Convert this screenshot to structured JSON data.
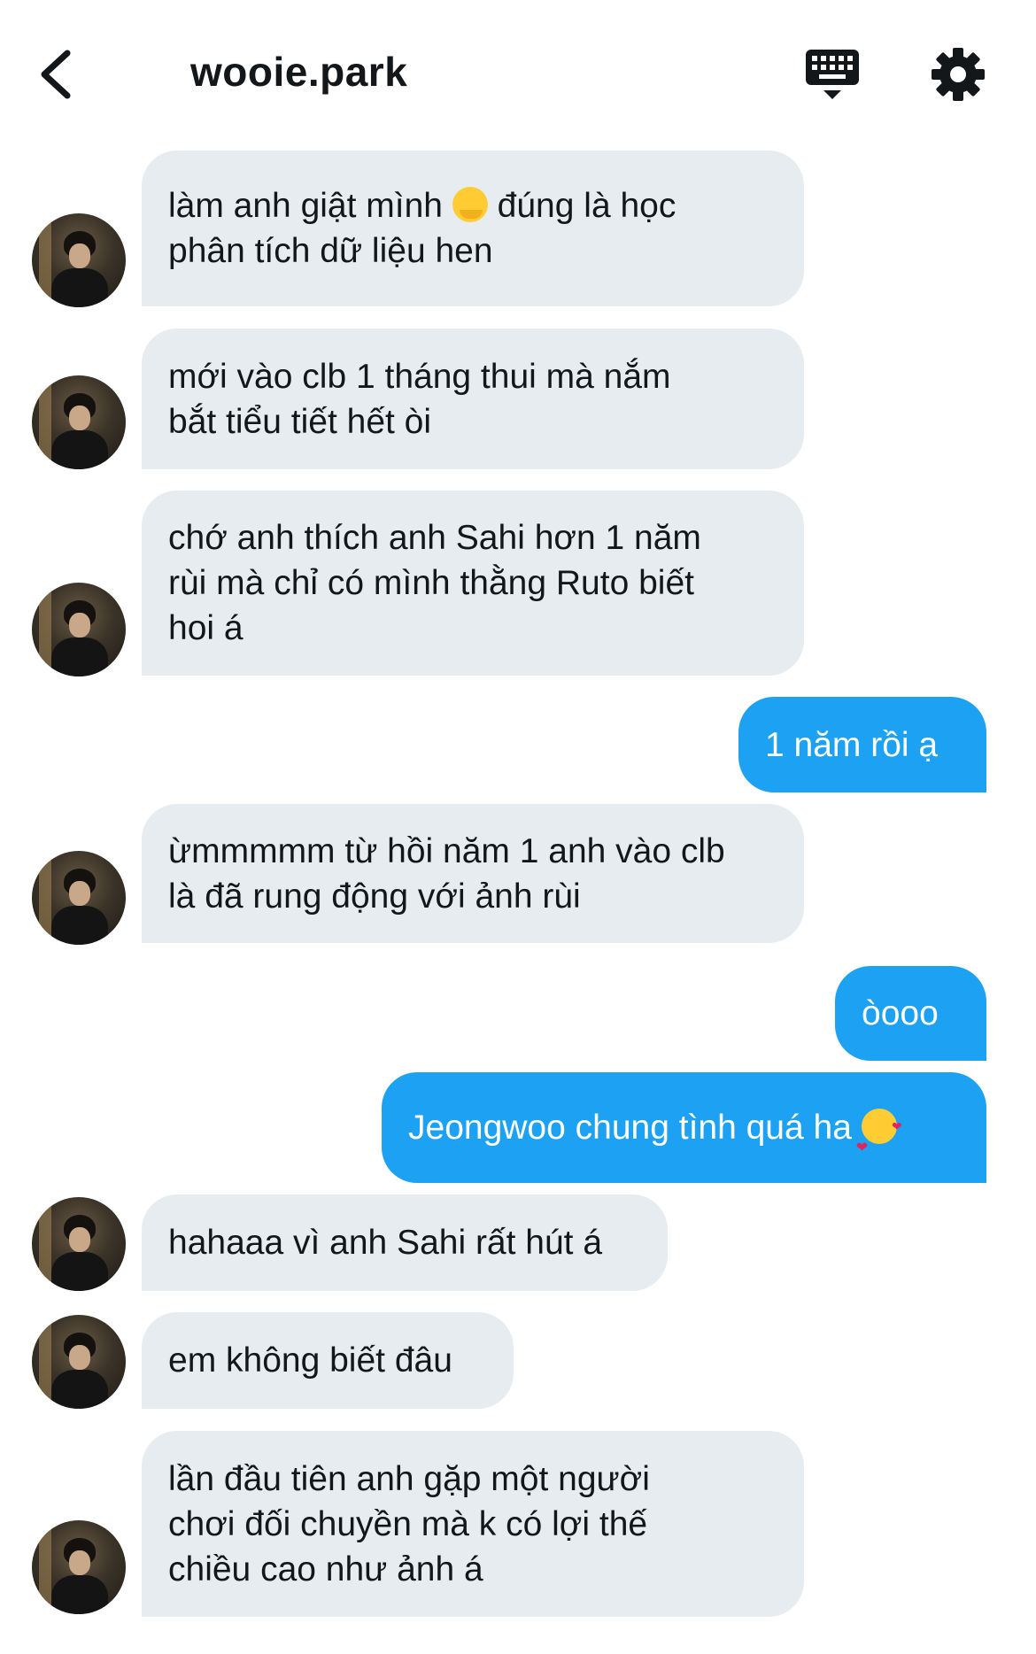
{
  "header": {
    "title": "wooie.park",
    "back_icon": "chevron-left-icon",
    "keyboard_icon": "keyboard-icon",
    "settings_icon": "gear-icon"
  },
  "colors": {
    "incoming_bubble": "#e6ecf0",
    "outgoing_bubble": "#1da1f2",
    "text": "#14171a"
  },
  "messages": [
    {
      "from": "them",
      "text_before": "làm anh giật mình ",
      "emoji": "melting-face-emoji",
      "text_after": " đúng là học\nphân tích dữ liệu hen"
    },
    {
      "from": "them",
      "text": "mới vào clb 1 tháng thui mà nắm\nbắt tiểu tiết hết òi"
    },
    {
      "from": "them",
      "text": "chớ anh thích anh Sahi hơn 1 năm\nrùi mà chỉ có mình thằng Ruto biết\nhoi á"
    },
    {
      "from": "me",
      "text": "1 năm rồi ạ"
    },
    {
      "from": "them",
      "text": "ừmmmmm từ hồi năm 1 anh vào clb\nlà đã rung động với ảnh rùi"
    },
    {
      "from": "me",
      "text": "òooo"
    },
    {
      "from": "me",
      "text_before": "Jeongwoo chung tình quá ha ",
      "emoji": "smiling-face-with-hearts-emoji",
      "text_after": ""
    },
    {
      "from": "them",
      "text": "hahaaa vì anh Sahi rất hút á"
    },
    {
      "from": "them",
      "text": "em không biết đâu"
    },
    {
      "from": "them",
      "text": "lần đầu tiên anh gặp một người\nchơi đối chuyền mà k có lợi thế\nchiều cao như ảnh á"
    }
  ]
}
